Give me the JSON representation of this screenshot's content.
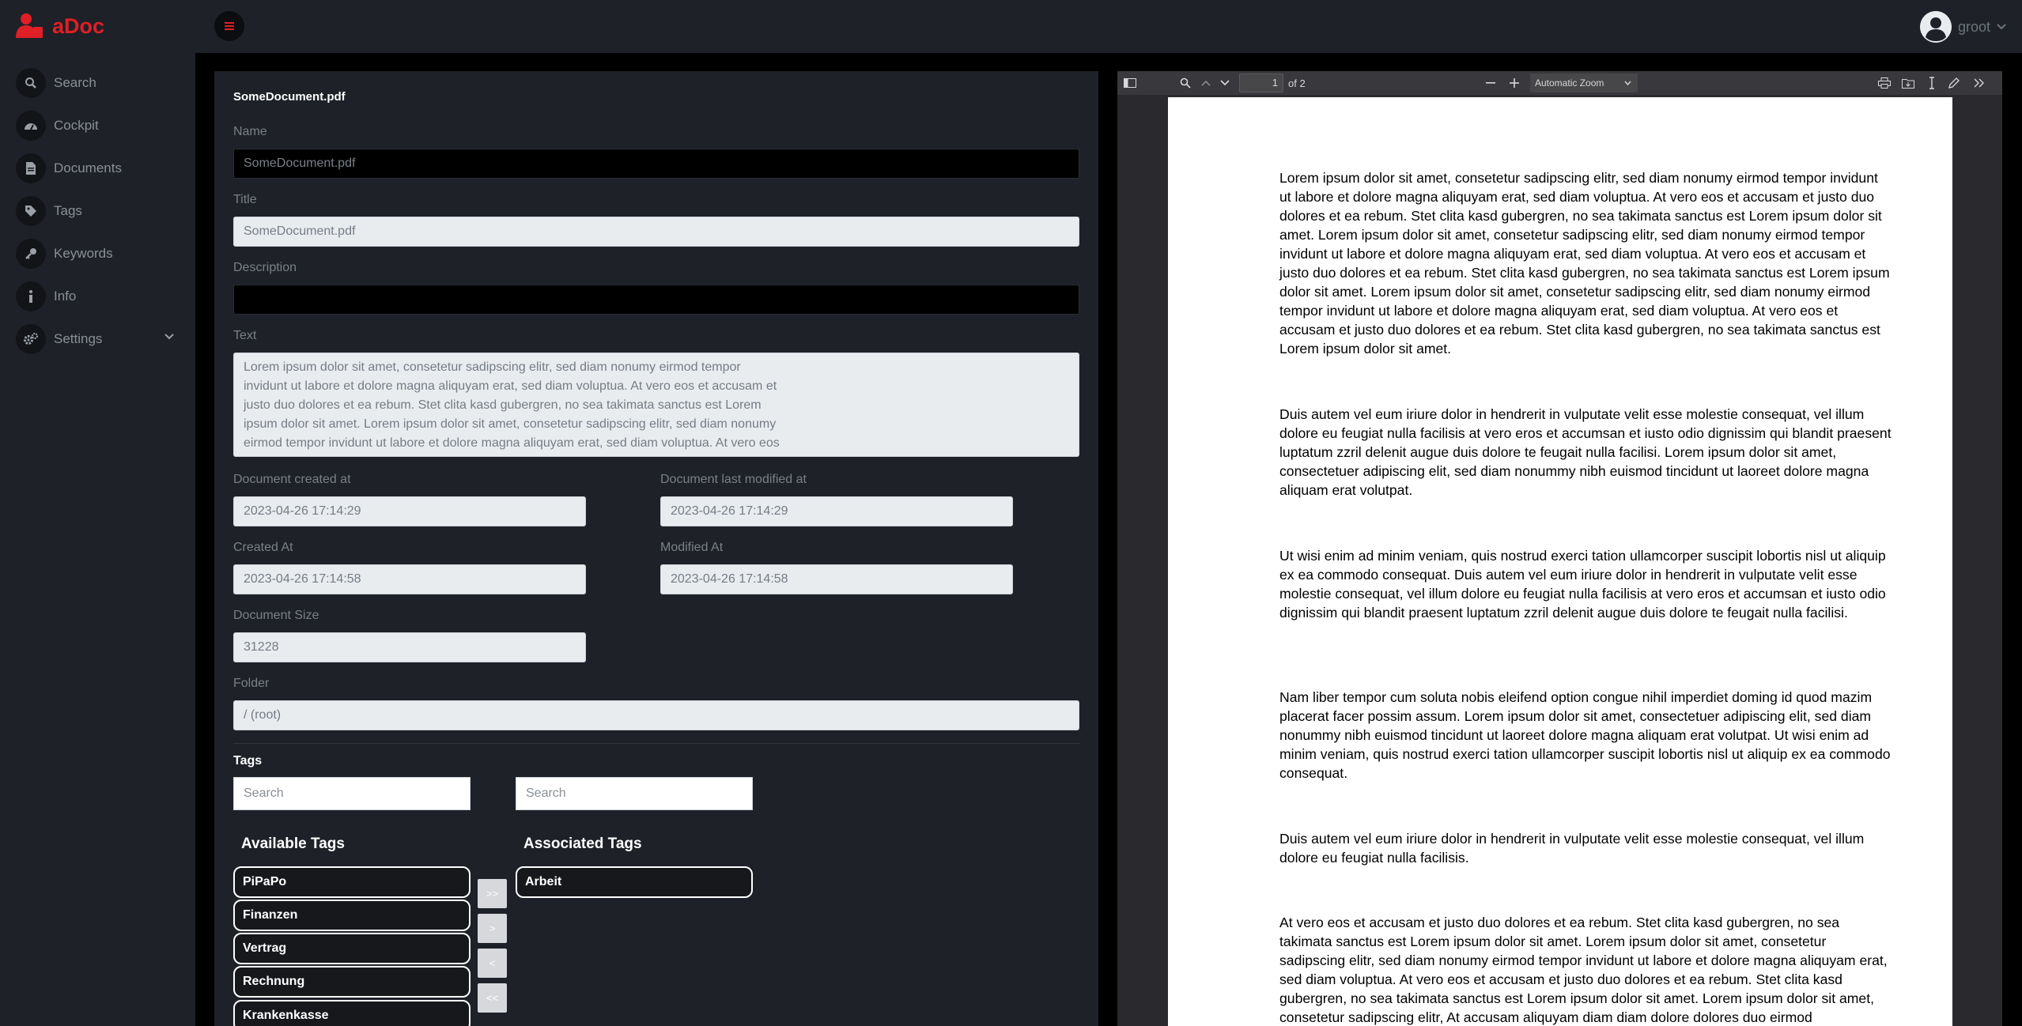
{
  "app": {
    "name": "aDoc",
    "user": "groot"
  },
  "sidebar": {
    "items": [
      {
        "label": "Search",
        "icon": "search-icon"
      },
      {
        "label": "Cockpit",
        "icon": "gauge-icon"
      },
      {
        "label": "Documents",
        "icon": "document-icon"
      },
      {
        "label": "Tags",
        "icon": "tag-icon"
      },
      {
        "label": "Keywords",
        "icon": "key-icon"
      },
      {
        "label": "Info",
        "icon": "info-icon"
      },
      {
        "label": "Settings",
        "icon": "gears-icon"
      }
    ]
  },
  "form": {
    "header": "SomeDocument.pdf",
    "name_label": "Name",
    "name_value": "SomeDocument.pdf",
    "title_label": "Title",
    "title_value": "SomeDocument.pdf",
    "description_label": "Description",
    "description_value": "",
    "text_label": "Text",
    "text_value": "Lorem ipsum dolor sit amet, consetetur sadipscing elitr, sed diam nonumy eirmod tempor\ninvidunt ut labore et dolore magna aliquyam erat, sed diam voluptua. At vero eos et accusam et\njusto duo dolores et ea rebum. Stet clita kasd gubergren, no sea takimata sanctus est Lorem\nipsum dolor sit amet. Lorem ipsum dolor sit amet, consetetur sadipscing elitr, sed diam nonumy\neirmod tempor invidunt ut labore et dolore magna aliquyam erat, sed diam voluptua. At vero eos",
    "doc_created_label": "Document created at",
    "doc_created_value": "2023-04-26 17:14:29",
    "doc_modified_label": "Document last modified at",
    "doc_modified_value": "2023-04-26 17:14:29",
    "created_label": "Created At",
    "created_value": "2023-04-26 17:14:58",
    "modified_label": "Modified At",
    "modified_value": "2023-04-26 17:14:58",
    "size_label": "Document Size",
    "size_value": "31228",
    "folder_label": "Folder",
    "folder_value": "/ (root)"
  },
  "tags": {
    "heading": "Tags",
    "search_placeholder_available": "Search",
    "search_placeholder_associated": "Search",
    "available_title": "Available Tags",
    "associated_title": "Associated Tags",
    "available": [
      "PiPaPo",
      "Finanzen",
      "Vertrag",
      "Rechnung",
      "Krankenkasse"
    ],
    "associated": [
      "Arbeit"
    ],
    "buttons": [
      ">>",
      ">",
      "<",
      "<<"
    ]
  },
  "pdf": {
    "page_number": "1",
    "page_of": "of 2",
    "zoom": "Automatic Zoom",
    "paragraphs": [
      "Lorem ipsum dolor sit amet, consetetur sadipscing elitr, sed diam nonumy eirmod tempor invidunt ut labore et dolore magna aliquyam erat, sed diam voluptua. At vero eos et accusam et justo duo dolores et ea rebum. Stet clita kasd gubergren, no sea takimata sanctus est Lorem ipsum dolor sit amet. Lorem ipsum dolor sit amet, consetetur sadipscing elitr, sed diam nonumy eirmod tempor invidunt ut labore et dolore magna aliquyam erat, sed diam voluptua. At vero eos et accusam et justo duo dolores et ea rebum. Stet clita kasd gubergren, no sea takimata sanctus est Lorem ipsum dolor sit amet. Lorem ipsum dolor sit amet, consetetur sadipscing elitr, sed diam nonumy eirmod tempor invidunt ut labore et dolore magna aliquyam erat, sed diam voluptua. At vero eos et accusam et justo duo dolores et ea rebum. Stet clita kasd gubergren, no sea takimata sanctus est Lorem ipsum dolor sit amet.",
      "Duis autem vel eum iriure dolor in hendrerit in vulputate velit esse molestie consequat, vel illum dolore eu feugiat nulla facilisis at vero eros et accumsan et iusto odio dignissim qui blandit praesent luptatum zzril delenit augue duis dolore te feugait nulla facilisi. Lorem ipsum dolor sit amet, consectetuer adipiscing elit, sed diam nonummy nibh euismod tincidunt ut laoreet dolore magna aliquam erat volutpat.",
      "Ut wisi enim ad minim veniam, quis nostrud exerci tation ullamcorper suscipit lobortis nisl ut aliquip ex ea commodo consequat. Duis autem vel eum iriure dolor in hendrerit in vulputate velit esse molestie consequat, vel illum dolore eu feugiat nulla facilisis at vero eros et accumsan et iusto odio dignissim qui blandit praesent luptatum zzril delenit augue duis dolore te feugait nulla facilisi.",
      "Nam liber tempor cum soluta nobis eleifend option congue nihil imperdiet doming id quod mazim placerat facer possim assum. Lorem ipsum dolor sit amet, consectetuer adipiscing elit, sed diam nonummy nibh euismod tincidunt ut laoreet dolore magna aliquam erat volutpat. Ut wisi enim ad minim veniam, quis nostrud exerci tation ullamcorper suscipit lobortis nisl ut aliquip ex ea commodo consequat.",
      "Duis autem vel eum iriure dolor in hendrerit in vulputate velit esse molestie consequat, vel illum dolore eu feugiat nulla facilisis.",
      "At vero eos et accusam et justo duo dolores et ea rebum. Stet clita kasd gubergren, no sea takimata sanctus est Lorem ipsum dolor sit amet. Lorem ipsum dolor sit amet, consetetur sadipscing elitr, sed diam nonumy eirmod tempor invidunt ut labore et dolore magna aliquyam erat, sed diam voluptua. At vero eos et accusam et justo duo dolores et ea rebum. Stet clita kasd gubergren, no sea takimata sanctus est Lorem ipsum dolor sit amet. Lorem ipsum dolor sit amet, consetetur sadipscing elitr, At accusam aliquyam diam diam dolore dolores duo eirmod"
    ]
  },
  "colors": {
    "brand": "#e01f26",
    "panel": "#1e2127",
    "background": "#000000"
  }
}
